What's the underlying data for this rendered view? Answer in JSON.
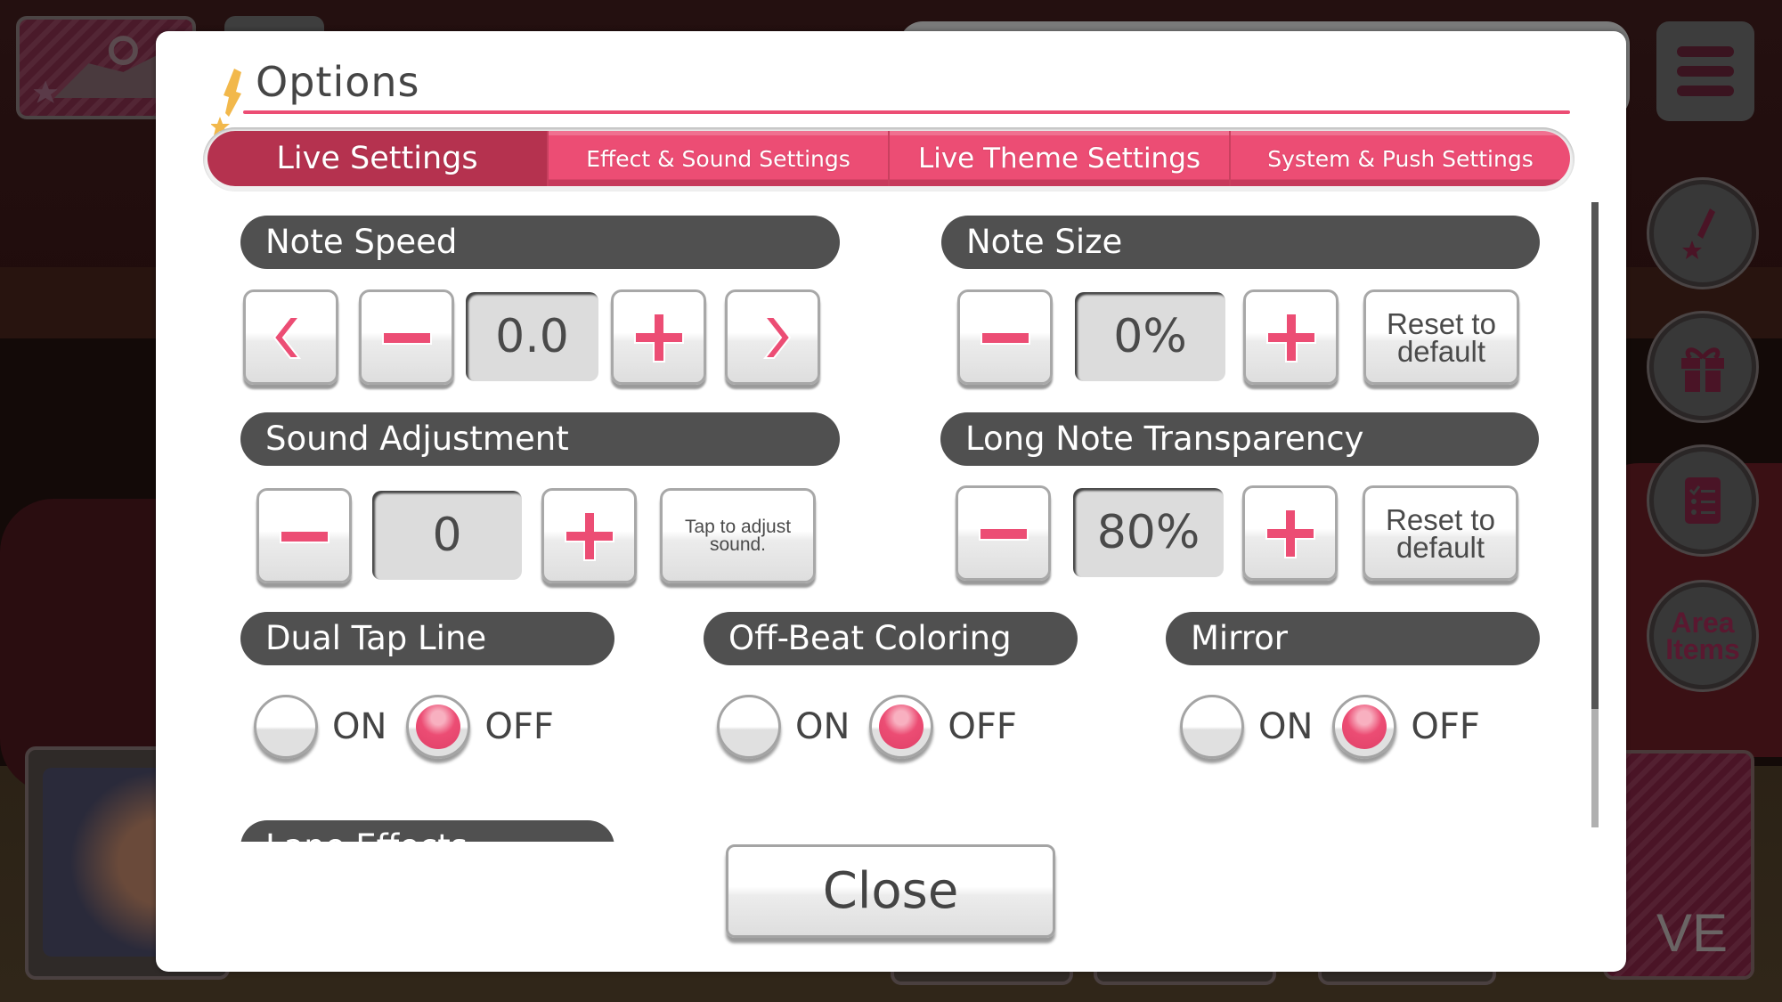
{
  "modal": {
    "title": "Options",
    "tabs": [
      {
        "label": "Live Settings",
        "active": true
      },
      {
        "label": "Effect & Sound Settings",
        "active": false
      },
      {
        "label": "Live Theme Settings",
        "active": false
      },
      {
        "label": "System & Push Settings",
        "active": false
      }
    ],
    "note_speed": {
      "label": "Note Speed",
      "value": "0.0",
      "icons": [
        "chevron-left-icon",
        "minus-icon",
        "plus-icon",
        "chevron-right-icon"
      ]
    },
    "note_size": {
      "label": "Note Size",
      "value": "0%",
      "reset_label_line1": "Reset to",
      "reset_label_line2": "default"
    },
    "sound_adjustment": {
      "label": "Sound Adjustment",
      "value": "0",
      "tap_label_line1": "Tap to adjust",
      "tap_label_line2": "sound."
    },
    "long_note_transparency": {
      "label": "Long Note Transparency",
      "value": "80%",
      "reset_label_line1": "Reset to",
      "reset_label_line2": "default"
    },
    "toggles": [
      {
        "label": "Dual Tap Line",
        "on_label": "ON",
        "off_label": "OFF",
        "selected": "OFF"
      },
      {
        "label": "Off-Beat Coloring",
        "on_label": "ON",
        "off_label": "OFF",
        "selected": "OFF"
      },
      {
        "label": "Mirror",
        "on_label": "ON",
        "off_label": "OFF",
        "selected": "OFF"
      }
    ],
    "partial_section_label": "Lane Effects",
    "scroll_position": 0.0,
    "scroll_visible_fraction": 0.81,
    "close_label": "Close"
  },
  "background": {
    "area_items_label_line1": "Area",
    "area_items_label_line2": "Items",
    "live_label": "VE"
  },
  "colors": {
    "accent": "#ec4d74",
    "tab_active": "#b5324f",
    "header_pill": "#505050",
    "title_icon": "#f2b84b"
  }
}
